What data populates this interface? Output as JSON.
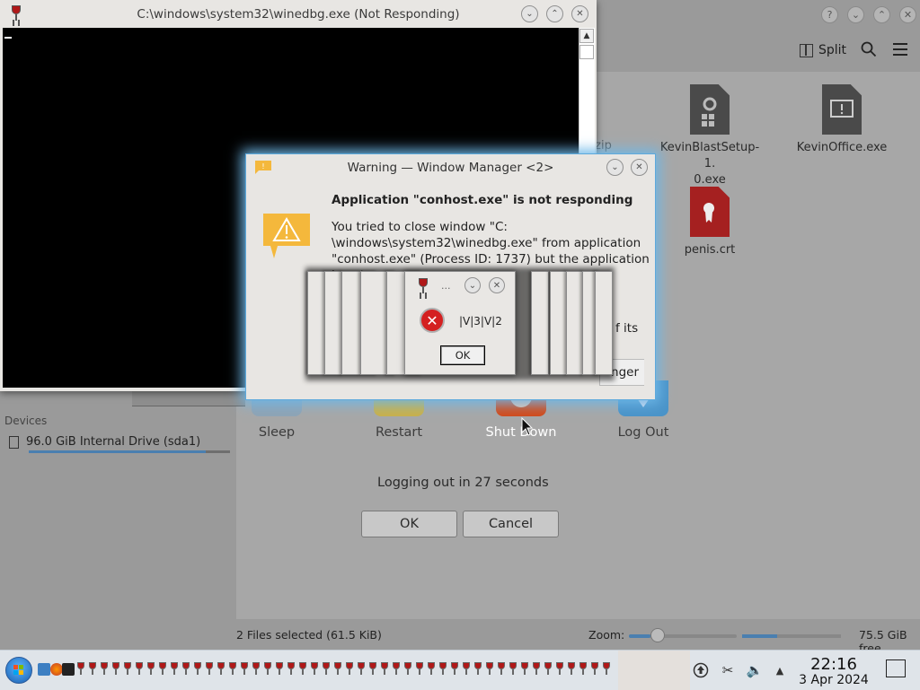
{
  "file_manager": {
    "toolbar": {
      "split_label": "Split"
    },
    "files": [
      {
        "name": "KevinBlastSetup-1.0.exe",
        "line1": "KevinBlastSetup-1.",
        "line2": "0.exe"
      },
      {
        "name": "KevinOffice.exe",
        "line1": "KevinOffice.exe",
        "line2": ""
      },
      {
        "name": "penis.crt",
        "line1": "penis.crt",
        "line2": ""
      }
    ],
    "partial_file_label": ".zip",
    "sidebar": {
      "devices_heading": "Devices",
      "drive_label": "96.0 GiB Internal Drive (sda1)",
      "drive_usage_fraction": 0.88
    },
    "status": {
      "selection": "2 Files selected (61.5 KiB)",
      "zoom_label": "Zoom:",
      "zoom_fraction": 0.2,
      "free_label": "75.5 GiB free",
      "free_bar_fraction": 0.35
    }
  },
  "logout_dialog": {
    "options": [
      {
        "label": "Sleep"
      },
      {
        "label": "Restart"
      },
      {
        "label": "Shut Down"
      },
      {
        "label": "Log Out"
      }
    ],
    "countdown": "Logging out in 27 seconds",
    "ok_label": "OK",
    "cancel_label": "Cancel"
  },
  "console_window": {
    "title": "C:\\windows\\system32\\winedbg.exe (Not Responding)"
  },
  "warning_dialog": {
    "title": "Warning — Window Manager <2>",
    "heading": "Application \"conhost.exe\" is not responding",
    "body_line1": "You tried to close window \"C:",
    "body_line2": "\\windows\\system32\\winedbg.exe\" from application",
    "body_line3": "\"conhost.exe\" (Process ID: 1737) but the application is not",
    "body_end": "f its",
    "button_fragment": "nger"
  },
  "error_popup": {
    "title": "...",
    "message": "|V|3|V|2",
    "ok_label": "OK"
  },
  "taskbar": {
    "clock_time": "22:16",
    "clock_date": "3 Apr 2024",
    "wine_task_count": 46
  },
  "colors": {
    "accent_blue": "#4a7fb0",
    "dialog_glow": "#6fb8e8",
    "error_red": "#d42020",
    "warning_yellow": "#f4b83c"
  }
}
